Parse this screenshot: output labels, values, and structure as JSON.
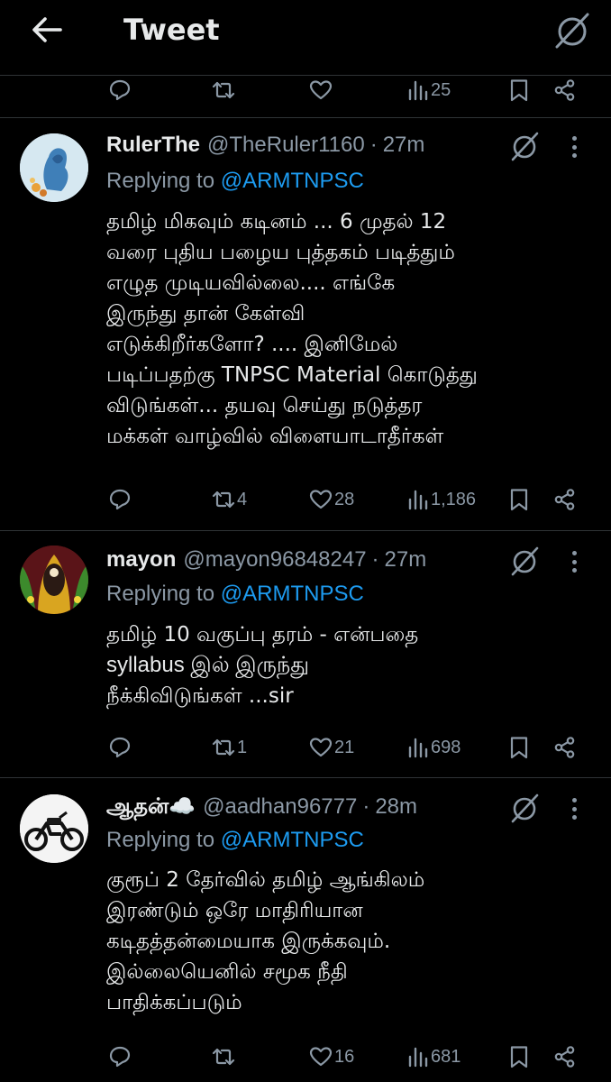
{
  "header": {
    "title": "Tweet",
    "back_icon": "arrow-left-icon",
    "mute_icon": "circle-slash-icon"
  },
  "top_actions": {
    "views": "25"
  },
  "tweets": [
    {
      "name": "RulerThe",
      "handle": "@TheRuler1160",
      "dot": "·",
      "time": "27m",
      "replying_label": "Replying to",
      "replying_to": "@ARMTNPSC",
      "lines": [
        "தமிழ் மிகவும் கடினம் ... 6 முதல் 12",
        "வரை புதிய பழைய புத்தகம் படித்தும்",
        "எழுத முடியவில்லை.... எங்கே",
        "இருந்து தான் கேள்வி",
        "எடுக்கிறீர்களோ? .... இனிமேல்",
        "படிப்பதற்கு TNPSC Material கொடுத்து",
        "விடுங்கள்... தயவு செய்து நடுத்தர",
        "மக்கள் வாழ்வில் விளையாடாதீர்கள்"
      ],
      "retweets": "4",
      "likes": "28",
      "views": "1,186"
    },
    {
      "name": "mayon",
      "handle": "@mayon96848247",
      "dot": "·",
      "time": "27m",
      "replying_label": "Replying to",
      "replying_to": "@ARMTNPSC",
      "lines": [
        "தமிழ் 10 வகுப்பு தரம் - என்பதை",
        "syllabus இல் இருந்து",
        "நீக்கிவிடுங்கள் ...sir"
      ],
      "retweets": "1",
      "likes": "21",
      "views": "698"
    },
    {
      "name": "ஆதன்☁️",
      "handle": "@aadhan96777",
      "dot": "·",
      "time": "28m",
      "replying_label": "Replying to",
      "replying_to": "@ARMTNPSC",
      "lines": [
        "குரூப் 2 தேர்வில் தமிழ் ஆங்கிலம்",
        "இரண்டும் ஒரே மாதிரியான",
        "கடிதத்தன்மையாக இருக்கவும்.",
        "இல்லையெனில் சமூக நீதி",
        "பாதிக்கப்படும்"
      ],
      "retweets": "",
      "likes": "16",
      "views": "681"
    }
  ],
  "colors": {
    "background": "#000000",
    "text": "#e7e9ea",
    "muted": "#8b98a5",
    "link": "#1d9bf0",
    "divider": "#2f3336"
  }
}
